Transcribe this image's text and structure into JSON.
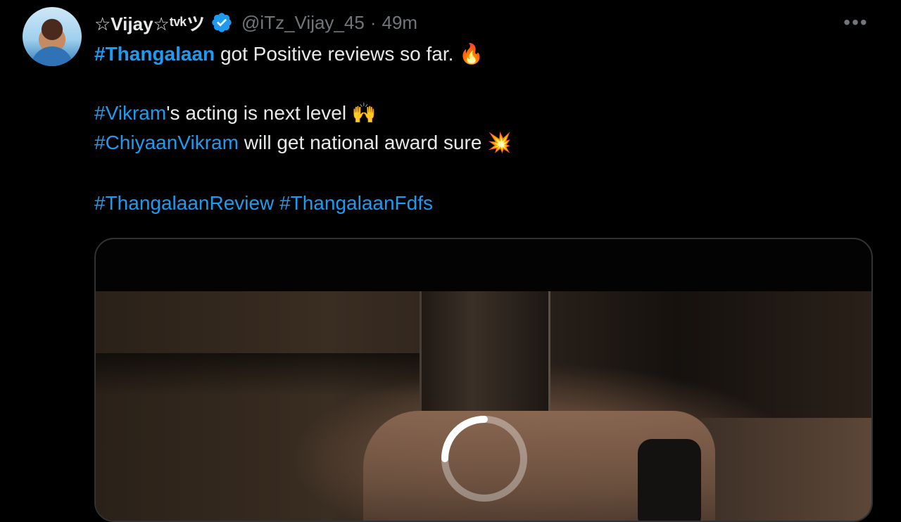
{
  "tweet": {
    "display_name": "☆Vijay☆ᵗᵛᵏツ",
    "handle": "@iTz_Vijay_45",
    "separator": "·",
    "time": "49m",
    "more_label": "•••",
    "lines": {
      "l1_tag": "#Thangalaan",
      "l1_text": " got Positive reviews so far. ",
      "l1_emoji": "🔥",
      "l2_tag": "#Vikram",
      "l2_text": "'s acting is next level ",
      "l2_emoji": "🙌",
      "l3_tag": "#ChiyaanVikram",
      "l3_text": " will get national award sure ",
      "l3_emoji": "💥",
      "l4_tag1": "#ThangalaanReview",
      "l4_tag2": "#ThangalaanFdfs"
    }
  },
  "media": {
    "state": "loading"
  },
  "colors": {
    "background": "#000000",
    "hashtag": "#1d9bf0",
    "verified": "#1d9bf0",
    "muted": "#71767b",
    "text": "#e7e9ea"
  },
  "icons": {
    "verified": "verified-badge-icon",
    "more": "more-horizontal-icon",
    "spinner": "loading-spinner-icon"
  }
}
